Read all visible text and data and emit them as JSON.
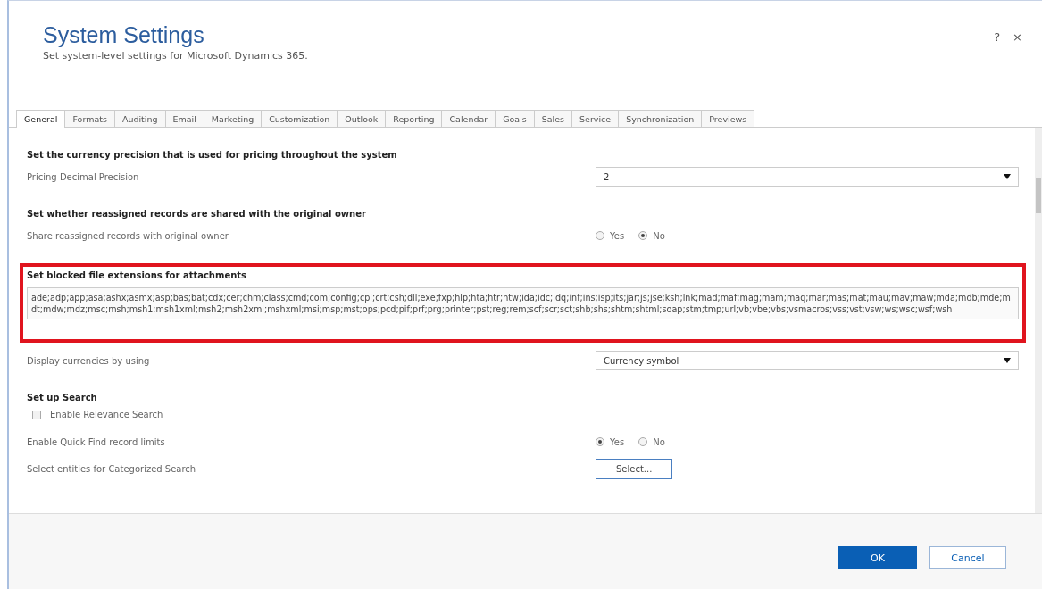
{
  "dialog": {
    "title": "System Settings",
    "subtitle": "Set system-level settings for Microsoft Dynamics 365.",
    "help": "?",
    "close": "×"
  },
  "tabs": [
    {
      "label": "General",
      "selected": true
    },
    {
      "label": "Formats",
      "selected": false
    },
    {
      "label": "Auditing",
      "selected": false
    },
    {
      "label": "Email",
      "selected": false
    },
    {
      "label": "Marketing",
      "selected": false
    },
    {
      "label": "Customization",
      "selected": false
    },
    {
      "label": "Outlook",
      "selected": false
    },
    {
      "label": "Reporting",
      "selected": false
    },
    {
      "label": "Calendar",
      "selected": false
    },
    {
      "label": "Goals",
      "selected": false
    },
    {
      "label": "Sales",
      "selected": false
    },
    {
      "label": "Service",
      "selected": false
    },
    {
      "label": "Synchronization",
      "selected": false
    },
    {
      "label": "Previews",
      "selected": false
    }
  ],
  "sections": [
    {
      "heading": "Set the currency precision that is used for pricing throughout the system",
      "highlighted": false,
      "rows": [
        {
          "kind": "select",
          "label": "Pricing Decimal Precision",
          "value": "2"
        }
      ]
    },
    {
      "heading": "Set whether reassigned records are shared with the original owner",
      "highlighted": false,
      "rows": [
        {
          "kind": "radio",
          "label": "Share reassigned records with original owner",
          "options": [
            {
              "label": "Yes",
              "selected": false
            },
            {
              "label": "No",
              "selected": true
            }
          ]
        }
      ]
    },
    {
      "heading": "Set blocked file extensions for attachments",
      "highlighted": true,
      "rows": [
        {
          "kind": "textarea",
          "value": "ade;adp;app;asa;ashx;asmx;asp;bas;bat;cdx;cer;chm;class;cmd;com;config;cpl;crt;csh;dll;exe;fxp;hlp;hta;htr;htw;ida;idc;idq;inf;ins;isp;its;jar;js;jse;ksh;lnk;mad;maf;mag;mam;maq;mar;mas;mat;mau;mav;maw;mda;mdb;mde;mdt;mdw;mdz;msc;msh;msh1;msh1xml;msh2;msh2xml;mshxml;msi;msp;mst;ops;pcd;pif;prf;prg;printer;pst;reg;rem;scf;scr;sct;shb;shs;shtm;shtml;soap;stm;tmp;url;vb;vbe;vbs;vsmacros;vss;vst;vsw;ws;wsc;wsf;wsh"
        }
      ]
    },
    {
      "highlighted": false,
      "rows": [
        {
          "kind": "select",
          "label": "Display currencies by using",
          "value": "Currency symbol"
        }
      ]
    },
    {
      "heading": "Set up Search",
      "highlighted": false,
      "rows": [
        {
          "kind": "checkbox",
          "label": "Enable Relevance Search",
          "checked": false
        },
        {
          "kind": "radio",
          "label": "Enable Quick Find record limits",
          "options": [
            {
              "label": "Yes",
              "selected": true
            },
            {
              "label": "No",
              "selected": false
            }
          ]
        },
        {
          "kind": "button",
          "label": "Select entities for Categorized Search",
          "button": "Select..."
        }
      ]
    }
  ],
  "footer": {
    "ok": "OK",
    "cancel": "Cancel"
  }
}
